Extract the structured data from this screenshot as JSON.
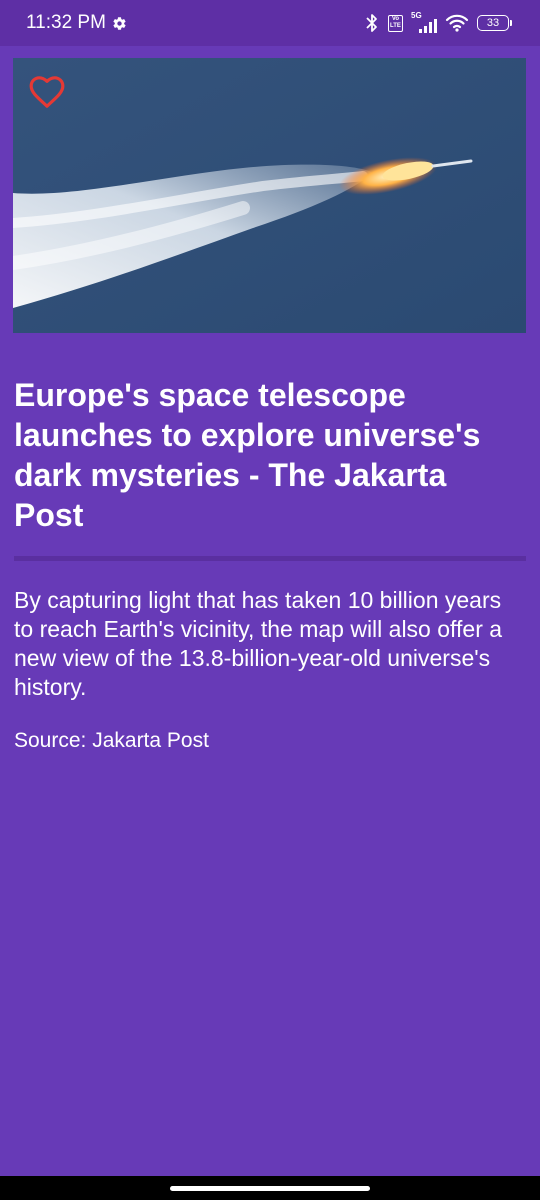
{
  "status_bar": {
    "time": "11:32 PM",
    "settings_icon": "gear-icon",
    "bluetooth_icon": "bluetooth-icon",
    "volte_label_top": "Vo",
    "volte_label_bottom": "LTE",
    "network_label": "5G",
    "wifi_icon": "wifi-icon",
    "battery_level": "33"
  },
  "article": {
    "hero_image_alt": "rocket-launch-image",
    "favorite_icon": "heart-outline-icon",
    "title": "Europe's space telescope launches to explore universe's dark mysteries - The Jakarta Post",
    "description": "By capturing light that has taken 10 billion years to reach Earth's vicinity, the map will also offer a new view of the 13.8-billion-year-old universe's history.",
    "source": "Source: Jakarta Post"
  },
  "colors": {
    "background": "#673ab7",
    "status_bar": "#5e2fa5",
    "favorite": "#e53935",
    "text": "#ffffff"
  }
}
